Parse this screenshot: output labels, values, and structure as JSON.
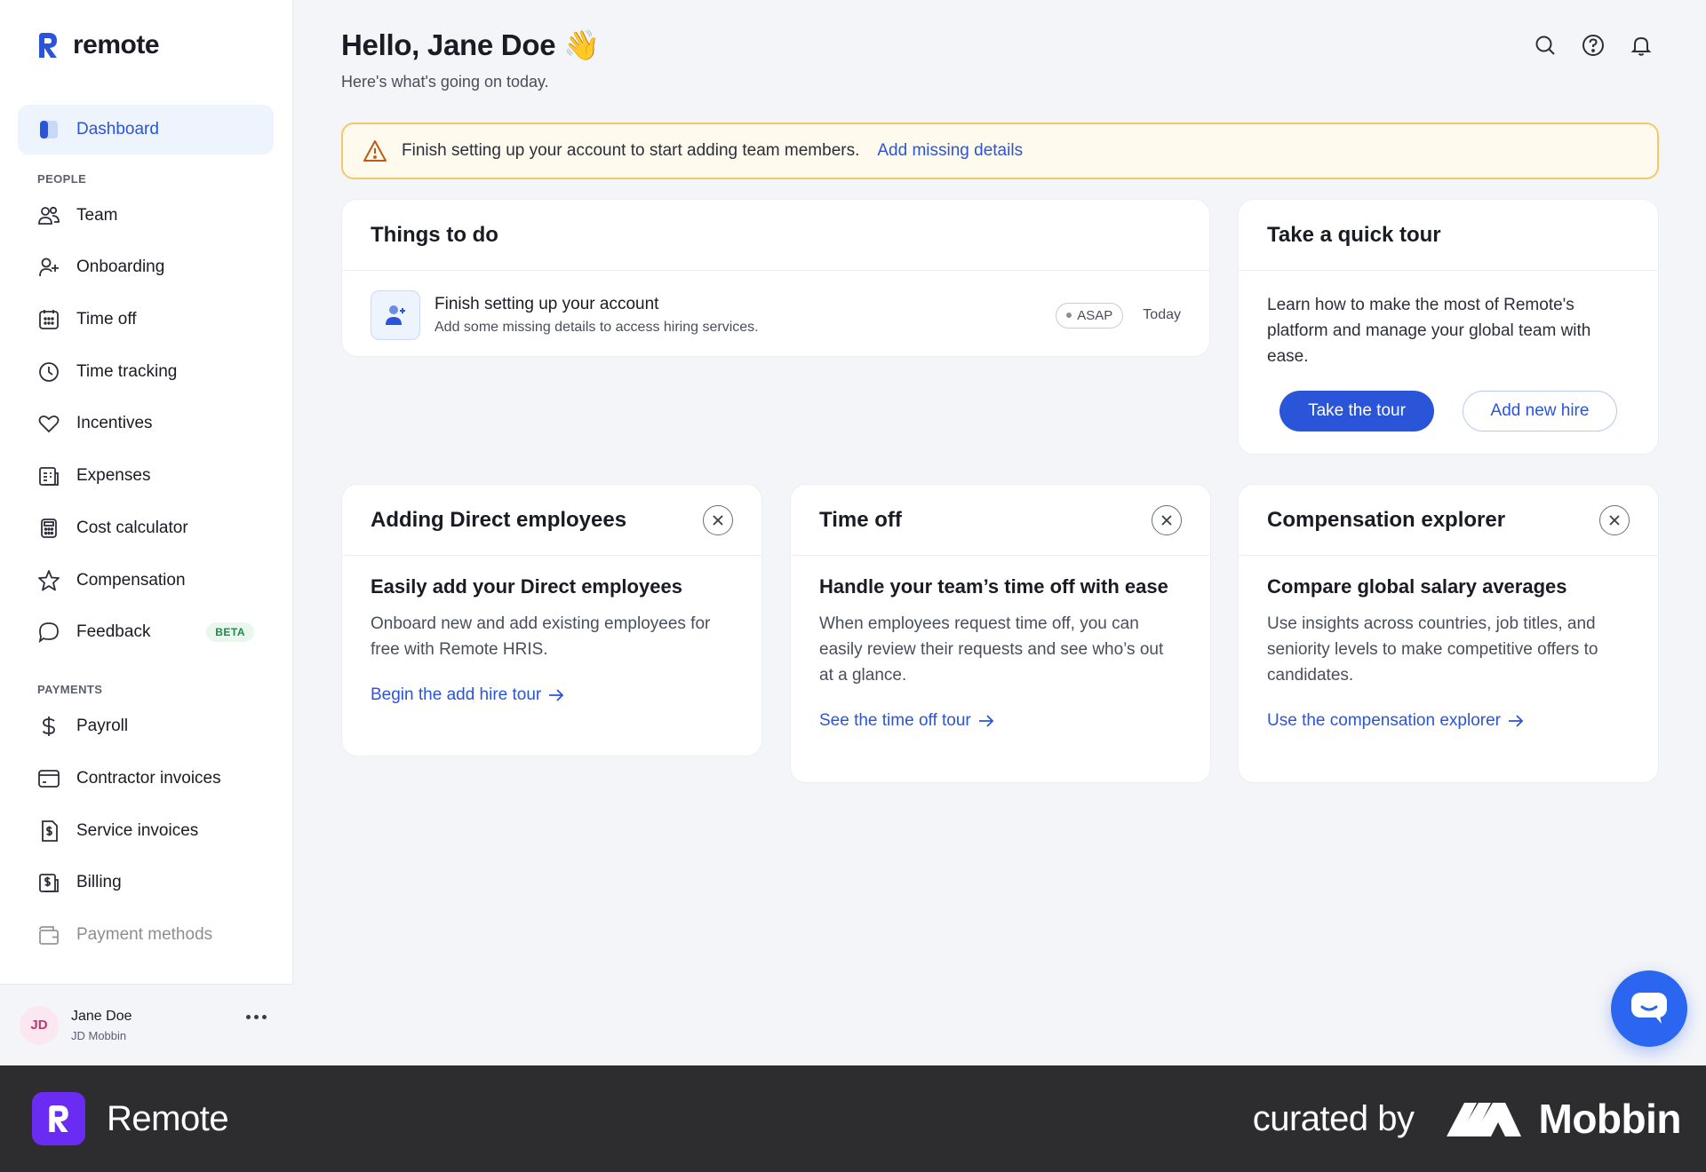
{
  "app": {
    "logo_text": "remote"
  },
  "sidebar": {
    "dashboard_label": "Dashboard",
    "people_section": "PEOPLE",
    "people_items": [
      {
        "label": "Team",
        "icon": "users-icon"
      },
      {
        "label": "Onboarding",
        "icon": "user-plus-icon"
      },
      {
        "label": "Time off",
        "icon": "calendar-icon"
      },
      {
        "label": "Time tracking",
        "icon": "clock-icon"
      },
      {
        "label": "Incentives",
        "icon": "heart-icon"
      },
      {
        "label": "Expenses",
        "icon": "receipt-icon"
      },
      {
        "label": "Cost calculator",
        "icon": "calculator-icon"
      },
      {
        "label": "Compensation",
        "icon": "star-icon"
      },
      {
        "label": "Feedback",
        "icon": "chat-bubble-icon",
        "badge": "BETA"
      }
    ],
    "payments_section": "PAYMENTS",
    "payments_items": [
      {
        "label": "Payroll",
        "icon": "dollar-icon"
      },
      {
        "label": "Contractor invoices",
        "icon": "card-icon"
      },
      {
        "label": "Service invoices",
        "icon": "invoice-icon"
      },
      {
        "label": "Billing",
        "icon": "billing-icon"
      },
      {
        "label": "Payment methods",
        "icon": "wallet-icon"
      }
    ]
  },
  "user": {
    "initials": "JD",
    "name": "Jane Doe",
    "org": "JD Mobbin"
  },
  "header": {
    "greeting": "Hello, Jane Doe 👋",
    "subtitle": "Here's what's going on today."
  },
  "alert": {
    "text": "Finish setting up your account to start adding team members.",
    "link": "Add missing details"
  },
  "todo": {
    "title": "Things to do",
    "item_title": "Finish setting up your account",
    "item_desc": "Add some missing details to access hiring services.",
    "priority": "ASAP",
    "due": "Today"
  },
  "tour": {
    "title": "Take a quick tour",
    "body": "Learn how to make the most of Remote's platform and manage your global team with ease.",
    "primary_btn": "Take the tour",
    "secondary_btn": "Add new hire"
  },
  "cards": {
    "direct": {
      "header": "Adding Direct employees",
      "title": "Easily add your Direct employees",
      "desc": "Onboard new and add existing employees for free with Remote HRIS.",
      "link": "Begin the add hire tour"
    },
    "timeoff": {
      "header": "Time off",
      "title": "Handle your team’s time off with ease",
      "desc": "When employees request time off, you can easily review their requests and see who’s out at a glance.",
      "link": "See the time off tour"
    },
    "comp": {
      "header": "Compensation explorer",
      "title": "Compare global salary averages",
      "desc": "Use insights across countries, job titles, and seniority levels to make competitive offers to candidates.",
      "link": "Use the compensation explorer"
    }
  },
  "footer": {
    "brand": "Remote",
    "curated": "curated by",
    "mobbin": "Mobbin"
  },
  "colors": {
    "accent": "#2a55d8",
    "alert_border": "#f5c769",
    "footer_bg": "#2d2d2f",
    "brand_purple": "#6a2bf2"
  }
}
